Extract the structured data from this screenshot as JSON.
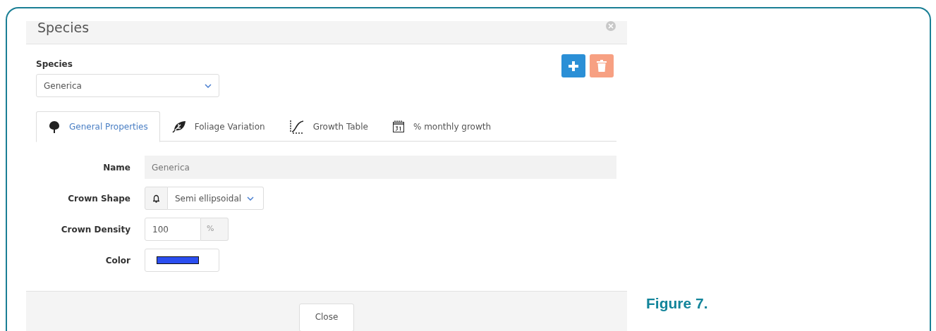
{
  "dialog": {
    "title": "Species",
    "species_field": {
      "label": "Species",
      "value": "Generica"
    },
    "tabs": [
      {
        "label": "General Properties",
        "selected": true
      },
      {
        "label": "Foliage Variation",
        "selected": false
      },
      {
        "label": "Growth Table",
        "selected": false
      },
      {
        "label": "% monthly growth",
        "selected": false
      }
    ],
    "fields": [
      {
        "kind": "text",
        "label": "Name",
        "value": "Generica",
        "disabled": true
      },
      {
        "kind": "select",
        "label": "Crown Shape",
        "value": "Semi ellipsoidal"
      },
      {
        "kind": "number",
        "label": "Crown Density",
        "value": "100",
        "unit": "%"
      },
      {
        "kind": "color",
        "label": "Color",
        "color": "#2b4ef0"
      }
    ],
    "footer_button": "Close"
  },
  "caption": "Figure 7."
}
